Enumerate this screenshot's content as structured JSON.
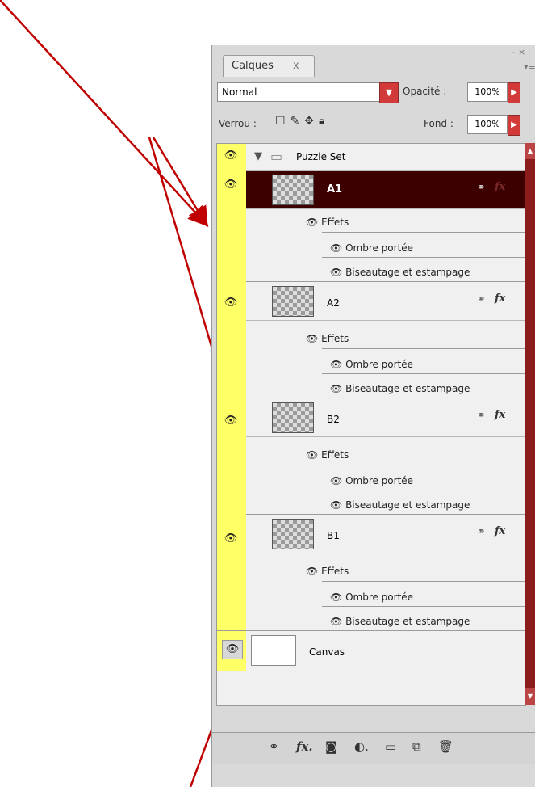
{
  "panel": {
    "tab_label": "Calques",
    "tab_close": "x",
    "minimize": "– ×",
    "menu": "▾≡",
    "blend_mode": "Normal",
    "opacity_label": "Opacité :",
    "opacity_value": "100%",
    "lock_label": "Verrou :",
    "fill_label": "Fond :",
    "fill_value": "100%"
  },
  "layers": [
    {
      "name": "Puzzle Set",
      "type": "group"
    },
    {
      "name": "A1",
      "type": "layer",
      "selected": true,
      "effects_label": "Effets",
      "effects": [
        "Ombre portée",
        "Biseautage et estampage"
      ]
    },
    {
      "name": "A2",
      "type": "layer",
      "selected": false,
      "effects_label": "Effets",
      "effects": [
        "Ombre portée",
        "Biseautage et estampage"
      ]
    },
    {
      "name": "B2",
      "type": "layer",
      "selected": false,
      "effects_label": "Effets",
      "effects": [
        "Ombre portée",
        "Biseautage et estampage"
      ]
    },
    {
      "name": "B1",
      "type": "layer",
      "selected": false,
      "effects_label": "Effets",
      "effects": [
        "Ombre portée",
        "Biseautage et estampage"
      ]
    },
    {
      "name": "Canvas",
      "type": "background"
    }
  ],
  "icons": {
    "eye": "eye-icon",
    "folder": "folder-icon",
    "link": "link-icon",
    "fx": "fx",
    "arrow_color": "#c00000"
  },
  "colors": {
    "visibility_strip": "#ffff66",
    "selected_row": "#3d0000",
    "dropdown": "#d23a3a"
  }
}
